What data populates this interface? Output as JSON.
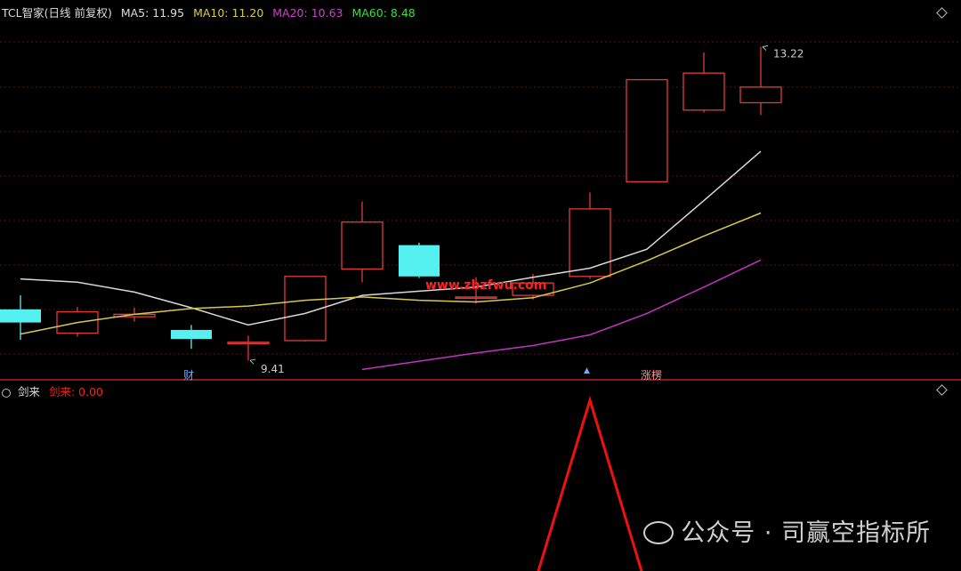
{
  "header": {
    "title": "TCL智家(日线 前复权)",
    "ma5": "MA5: 11.95",
    "ma10": "MA10: 11.20",
    "ma20": "MA20: 10.63",
    "ma60": "MA60: 8.48"
  },
  "indicator": {
    "name": "剑来",
    "value_label": "剑来: 0.00"
  },
  "annotations": {
    "high_label": "13.22",
    "low_label": "9.41",
    "event_cai": "财",
    "event_zhangting": "涨楞"
  },
  "site_watermark": "www.zbzfwu.com",
  "watermark": "公众号 · 司赢空指标所",
  "colors": {
    "up": "#e23b3b",
    "down": "#55f0f0",
    "ma5": "#d8d8d8",
    "ma10": "#d6c94c",
    "ma20": "#c233c2",
    "ma60": "#3fdc3f",
    "signal": "#ee1111",
    "grid": "#5a1212"
  },
  "chart_data": {
    "type": "candlestick",
    "price_ylim": [
      9.25,
      13.55
    ],
    "candles": [
      {
        "open": 10.03,
        "close": 9.87,
        "high": 10.2,
        "low": 9.66
      },
      {
        "open": 9.74,
        "close": 10.0,
        "high": 10.06,
        "low": 9.7
      },
      {
        "open": 9.94,
        "close": 9.97,
        "high": 10.05,
        "low": 9.88
      },
      {
        "open": 9.78,
        "close": 9.67,
        "high": 9.84,
        "low": 9.55
      },
      {
        "open": 9.63,
        "close": 9.63,
        "high": 9.71,
        "low": 9.41
      },
      {
        "open": 9.65,
        "close": 10.43,
        "high": 10.43,
        "low": 9.64
      },
      {
        "open": 10.52,
        "close": 11.09,
        "high": 11.34,
        "low": 10.36
      },
      {
        "open": 10.81,
        "close": 10.43,
        "high": 10.84,
        "low": 10.41
      },
      {
        "open": 10.18,
        "close": 10.18,
        "high": 10.42,
        "low": 10.1
      },
      {
        "open": 10.2,
        "close": 10.35,
        "high": 10.46,
        "low": 10.15
      },
      {
        "open": 10.43,
        "close": 11.25,
        "high": 11.45,
        "low": 10.4
      },
      {
        "open": 11.58,
        "close": 12.82,
        "high": 12.82,
        "low": 11.58
      },
      {
        "open": 12.45,
        "close": 12.9,
        "high": 13.15,
        "low": 12.42
      },
      {
        "open": 12.54,
        "close": 12.73,
        "high": 13.22,
        "low": 12.39
      }
    ],
    "ma5": [
      10.4,
      10.36,
      10.24,
      10.05,
      9.84,
      9.98,
      10.2,
      10.25,
      10.3,
      10.42,
      10.53,
      10.76,
      11.35,
      11.95
    ],
    "ma10": [
      9.73,
      9.87,
      9.97,
      10.04,
      10.07,
      10.14,
      10.18,
      10.14,
      10.12,
      10.17,
      10.35,
      10.62,
      10.92,
      11.2
    ],
    "ma20": [
      null,
      null,
      null,
      null,
      null,
      null,
      9.3,
      9.4,
      9.5,
      9.59,
      9.72,
      9.98,
      10.3,
      10.63
    ],
    "series": [
      {
        "name": "MA5",
        "values_ref": "ma5"
      },
      {
        "name": "MA10",
        "values_ref": "ma10"
      },
      {
        "name": "MA20",
        "values_ref": "ma20"
      },
      {
        "name": "MA60",
        "values_ref": "none"
      }
    ],
    "indicator_series": {
      "name": "剑来",
      "values": [
        0,
        0,
        0,
        0,
        0,
        0,
        0,
        0,
        0,
        0,
        1,
        0,
        0,
        0
      ]
    }
  }
}
